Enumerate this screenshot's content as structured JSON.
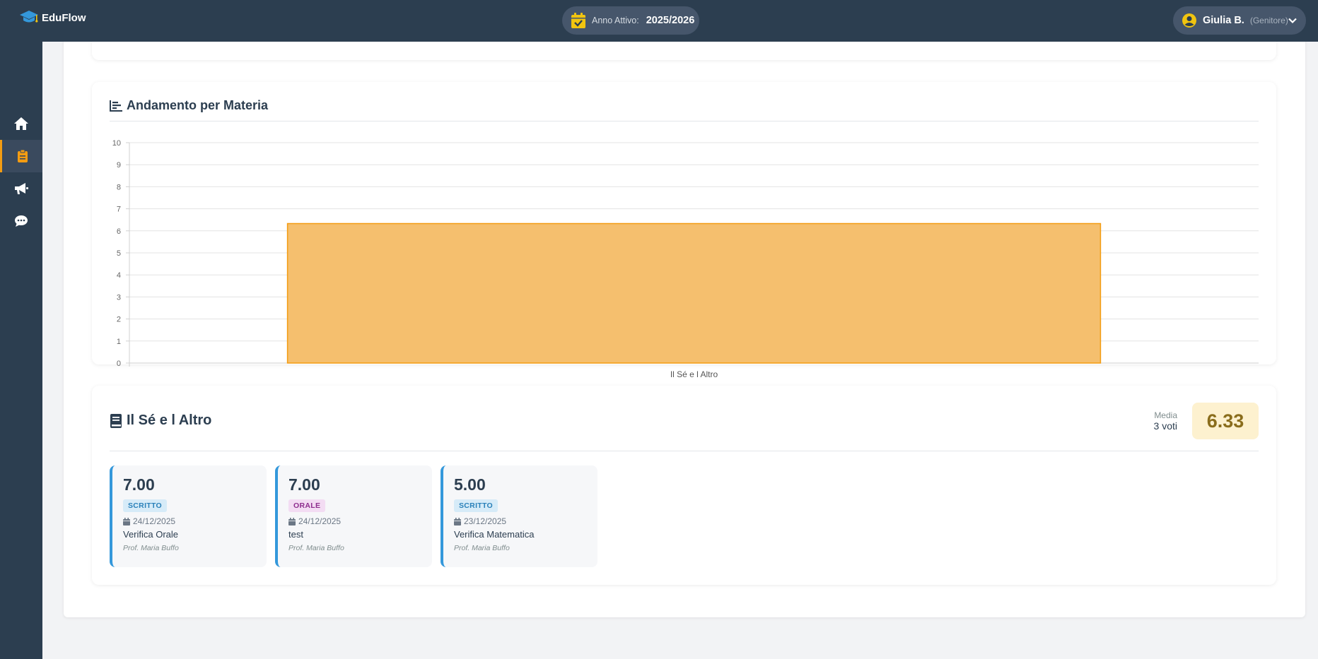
{
  "app": {
    "name": "EduFlow"
  },
  "header": {
    "year_label": "Anno Attivo:",
    "year_value": "2025/2026",
    "user_name": "Giulia B.",
    "user_role": "(Genitore)"
  },
  "sidebar": {
    "items": [
      {
        "icon": "home-icon"
      },
      {
        "icon": "clipboard-icon",
        "active": true
      },
      {
        "icon": "megaphone-icon"
      },
      {
        "icon": "chat-icon"
      }
    ]
  },
  "colors": {
    "topbar": "#2c3e50",
    "accent": "#f39c12",
    "bar_fill": "#f5bf6e",
    "bar_stroke": "#f39c12",
    "scritto": "#3498db",
    "orale": "#8e2d8e"
  },
  "chart_section": {
    "title": "Andamento per Materia"
  },
  "chart_data": {
    "type": "bar",
    "categories": [
      "Il Sé e l Altro"
    ],
    "values": [
      6.33
    ],
    "title": "",
    "xlabel": "",
    "ylabel": "",
    "ylim": [
      0,
      10
    ],
    "yticks": [
      0,
      1,
      2,
      3,
      4,
      5,
      6,
      7,
      8,
      9,
      10
    ],
    "grid": true,
    "legend": "none"
  },
  "subject": {
    "title": "Il Sé e l Altro",
    "media_label": "Media",
    "media_count": "3 voti",
    "media_value": "6.33"
  },
  "grades": [
    {
      "value": "7.00",
      "type": "SCRITTO",
      "date": "24/12/2025",
      "desc": "Verifica Orale",
      "teacher": "Prof. Maria Buffo"
    },
    {
      "value": "7.00",
      "type": "ORALE",
      "date": "24/12/2025",
      "desc": "test",
      "teacher": "Prof. Maria Buffo"
    },
    {
      "value": "5.00",
      "type": "SCRITTO",
      "date": "23/12/2025",
      "desc": "Verifica Matematica",
      "teacher": "Prof. Maria Buffo"
    }
  ]
}
